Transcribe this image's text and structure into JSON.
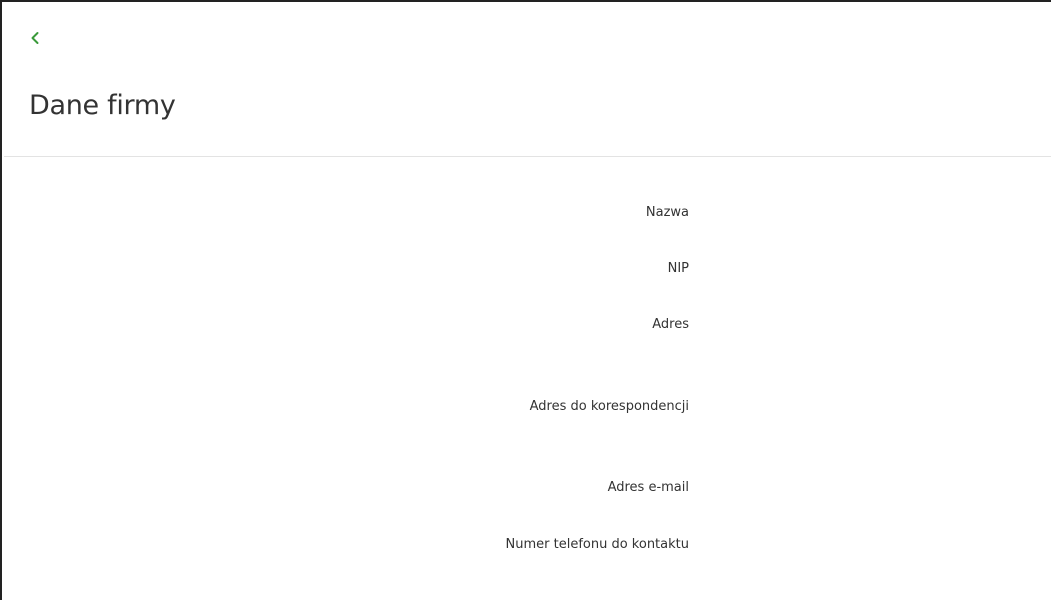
{
  "header": {
    "back_icon": "chevron-left-icon",
    "accent_color": "#3a9a3a",
    "title": "Dane firmy"
  },
  "company_details": {
    "fields": [
      {
        "label": "Nazwa"
      },
      {
        "label": "NIP"
      },
      {
        "label": "Adres"
      },
      {
        "label": "Adres do korespondencji"
      },
      {
        "label": "Adres e-mail"
      },
      {
        "label": "Numer telefonu do kontaktu"
      }
    ]
  }
}
